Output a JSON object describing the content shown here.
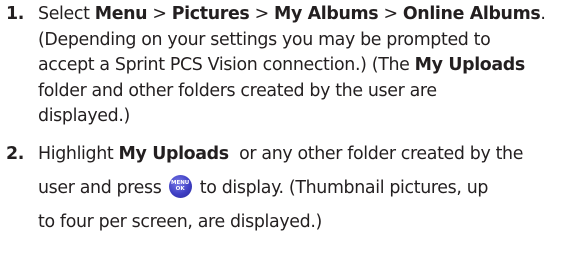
{
  "steps": [
    {
      "number": "1.",
      "lines": {
        "l1": {
          "t1": "Select ",
          "b1": "Menu",
          "t2": " > ",
          "b2": "Pictures",
          "t3": " > ",
          "b3": "My Albums",
          "t4": " > ",
          "b4": "Online Albums",
          "t5": "."
        },
        "l2": "(Depending on your settings you may be prompted to",
        "l3": "accept a Sprint PCS Vision connection.) (The ",
        "l3_bold": "My Uploads",
        "l4": "folder and other folders created by the user are",
        "l5": "displayed.)"
      }
    },
    {
      "number": "2.",
      "lines": {
        "l1_t1": "Highlight ",
        "l1_b1": "My Uploads",
        "l1_t2": "  or any other folder created by the",
        "l2_t1": "user and press ",
        "l2_t2": " to display. (Thumbnail pictures, up",
        "l3": "to four per screen, are displayed.)"
      }
    }
  ],
  "menu_key": {
    "top_label": "MENU",
    "bottom_label": "OK",
    "icon": "menu-ok-key-icon",
    "color": "#3f3fc4"
  }
}
